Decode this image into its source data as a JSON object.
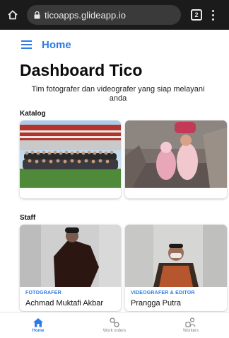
{
  "browser": {
    "url": "ticoapps.glideapp.io",
    "tab_count": "2"
  },
  "header": {
    "title": "Home"
  },
  "page": {
    "title": "Dashboard Tico",
    "subtitle": "Tim fotografer dan videografer yang siap melayani anda"
  },
  "katalog": {
    "label": "Katalog"
  },
  "staff": {
    "label": "Staff",
    "members": [
      {
        "role": "FOTOGRAFER",
        "name": "Achmad Muktafi Akbar"
      },
      {
        "role": "VIDEOGRAFER & EDITOR",
        "name": "Prangga Putra"
      }
    ]
  },
  "nav": {
    "items": [
      {
        "label": "Home",
        "icon": "home-icon",
        "active": true
      },
      {
        "label": "Work orders",
        "icon": "work-orders-icon",
        "active": false
      },
      {
        "label": "Workers",
        "icon": "workers-icon",
        "active": false
      }
    ]
  },
  "colors": {
    "accent": "#2c7be5",
    "browser_bar": "#1b1b1b"
  }
}
